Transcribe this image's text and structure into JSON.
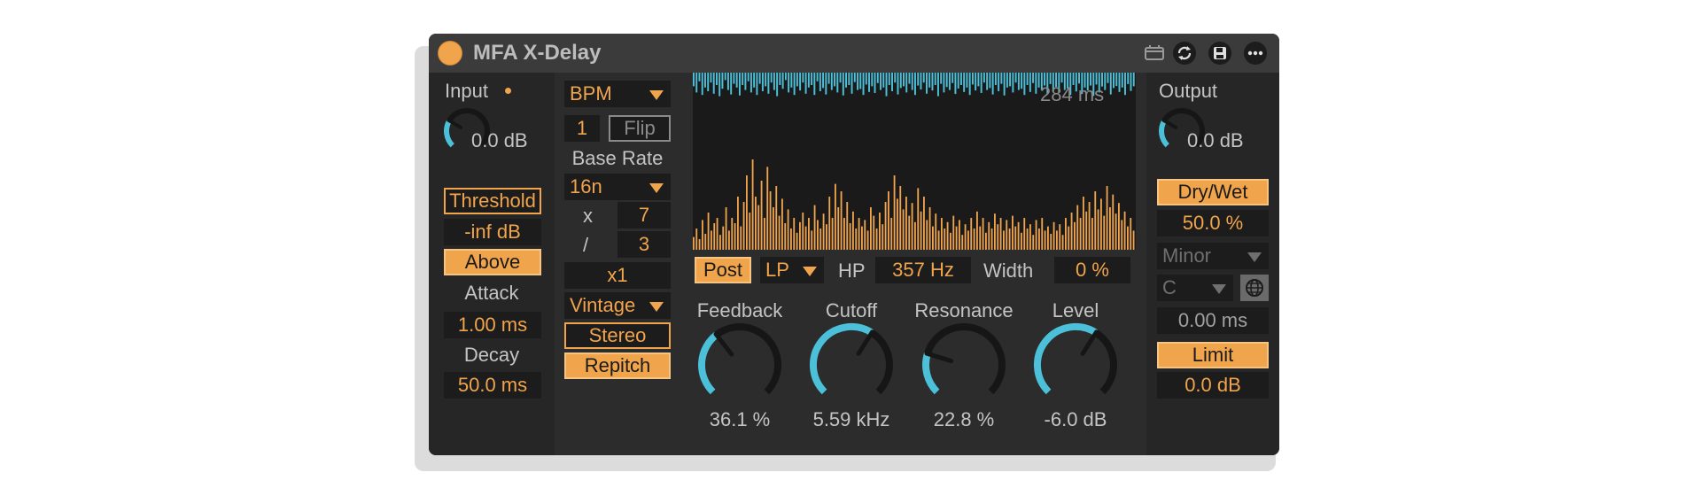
{
  "colors": {
    "accent": "#f0a44c",
    "cyan": "#4cc0d8",
    "panel": "#262626",
    "field": "#1c1c1c",
    "text": "#c4c4c4"
  },
  "header": {
    "title": "MFA X-Delay",
    "icons": [
      "clip-icon",
      "sync-icon",
      "save-icon",
      "more-icon"
    ]
  },
  "input": {
    "label": "Input",
    "value": "0.0 dB",
    "threshold_label": "Threshold",
    "threshold_value": "-inf dB",
    "above_label": "Above",
    "attack_label": "Attack",
    "attack_value": "1.00 ms",
    "decay_label": "Decay",
    "decay_value": "50.0 ms"
  },
  "timing": {
    "mode": "BPM",
    "count": "1",
    "flip_label": "Flip",
    "base_rate_label": "Base Rate",
    "base_rate": "16n",
    "mult_symbol": "x",
    "mult_value": "7",
    "div_symbol": "/",
    "div_value": "3",
    "multiplier": "x1",
    "style": "Vintage",
    "stereo_label": "Stereo",
    "repitch_label": "Repitch"
  },
  "display": {
    "delay_time": "284 ms",
    "top_wave": [
      0.55,
      0.8,
      0.35,
      0.9,
      0.6,
      0.75,
      0.4,
      0.85,
      0.5,
      0.95,
      0.65,
      0.3,
      0.7,
      0.88,
      0.45,
      0.6,
      0.92,
      0.5,
      0.7,
      0.35,
      0.8,
      0.6,
      0.9,
      0.45,
      0.75,
      0.55,
      0.85,
      0.4,
      0.7,
      0.95,
      0.5,
      0.65,
      0.3,
      0.8,
      0.6,
      0.9,
      0.55,
      0.72,
      0.4,
      0.85,
      0.6,
      0.5,
      0.9,
      0.35,
      0.75,
      0.62,
      0.88,
      0.45,
      0.7,
      0.55,
      0.8,
      0.4,
      0.92,
      0.6,
      0.5,
      0.85,
      0.38,
      0.7,
      0.66,
      0.9,
      0.48,
      0.78,
      0.55,
      0.82,
      0.42,
      0.7,
      0.6,
      0.95,
      0.5,
      0.75,
      0.4,
      0.88,
      0.62,
      0.55,
      0.8,
      0.45,
      0.7,
      0.9,
      0.52,
      0.68,
      0.4,
      0.85,
      0.6,
      0.72,
      0.5,
      0.95,
      0.45,
      0.8,
      0.58,
      0.7,
      0.42,
      0.86,
      0.64,
      0.5,
      0.78,
      0.6,
      0.9,
      0.48,
      0.72,
      0.55,
      0.82,
      0.4,
      0.7,
      0.62,
      0.88,
      0.5,
      0.75,
      0.45,
      0.92,
      0.6,
      0.55,
      0.8,
      0.4,
      0.7,
      0.65,
      0.9,
      0.5,
      0.78,
      0.42,
      0.85,
      0.6,
      0.7,
      0.52,
      0.88,
      0.46,
      0.75,
      0.58,
      0.82,
      0.4,
      0.7,
      0.64,
      0.9,
      0.5,
      0.76,
      0.44,
      0.86,
      0.6,
      0.72,
      0.52,
      0.94,
      0.48,
      0.8,
      0.56,
      0.7,
      0.42,
      0.88,
      0.62,
      0.54,
      0.78,
      0.6,
      0.9,
      0.46,
      0.74,
      0.55
    ],
    "bottom_wave": [
      0.12,
      0.2,
      0.1,
      0.28,
      0.15,
      0.35,
      0.18,
      0.25,
      0.3,
      0.14,
      0.22,
      0.4,
      0.18,
      0.3,
      0.25,
      0.5,
      0.22,
      0.45,
      0.7,
      0.35,
      0.85,
      0.5,
      0.42,
      0.65,
      0.3,
      0.78,
      0.55,
      0.4,
      0.6,
      0.32,
      0.48,
      0.25,
      0.38,
      0.2,
      0.3,
      0.16,
      0.26,
      0.35,
      0.22,
      0.3,
      0.18,
      0.42,
      0.28,
      0.2,
      0.34,
      0.24,
      0.5,
      0.3,
      0.62,
      0.4,
      0.55,
      0.3,
      0.45,
      0.25,
      0.36,
      0.2,
      0.3,
      0.22,
      0.28,
      0.18,
      0.4,
      0.32,
      0.2,
      0.35,
      0.24,
      0.45,
      0.55,
      0.3,
      0.7,
      0.48,
      0.6,
      0.38,
      0.5,
      0.32,
      0.44,
      0.26,
      0.58,
      0.36,
      0.5,
      0.28,
      0.4,
      0.22,
      0.34,
      0.18,
      0.3,
      0.2,
      0.26,
      0.16,
      0.32,
      0.22,
      0.28,
      0.14,
      0.24,
      0.18,
      0.3,
      0.2,
      0.36,
      0.22,
      0.3,
      0.16,
      0.26,
      0.2,
      0.34,
      0.24,
      0.3,
      0.18,
      0.28,
      0.2,
      0.32,
      0.22,
      0.26,
      0.16,
      0.3,
      0.2,
      0.24,
      0.14,
      0.28,
      0.2,
      0.3,
      0.18,
      0.22,
      0.15,
      0.26,
      0.18,
      0.24,
      0.14,
      0.3,
      0.22,
      0.35,
      0.26,
      0.42,
      0.3,
      0.5,
      0.36,
      0.45,
      0.3,
      0.55,
      0.38,
      0.48,
      0.32,
      0.6,
      0.4,
      0.52,
      0.34,
      0.44,
      0.28,
      0.36,
      0.22,
      0.3,
      0.18
    ]
  },
  "filter": {
    "post_label": "Post",
    "type": "LP",
    "hp_label": "HP",
    "hp_value": "357 Hz",
    "width_label": "Width",
    "width_value": "0 %"
  },
  "knobs": [
    {
      "name": "feedback",
      "label": "Feedback",
      "value": "36.1 %",
      "level": 0.36
    },
    {
      "name": "cutoff",
      "label": "Cutoff",
      "value": "5.59 kHz",
      "level": 0.62
    },
    {
      "name": "resonance",
      "label": "Resonance",
      "value": "22.8 %",
      "level": 0.23
    },
    {
      "name": "level",
      "label": "Level",
      "value": "-6.0 dB",
      "level": 0.62
    }
  ],
  "input_knob_level": 0.28,
  "output_knob_level": 0.28,
  "output": {
    "label": "Output",
    "value": "0.0 dB",
    "drywet_label": "Dry/Wet",
    "drywet_value": "50.0 %",
    "scale": "Minor",
    "key": "C",
    "time_value": "0.00 ms",
    "limit_label": "Limit",
    "limit_value": "0.0 dB"
  }
}
